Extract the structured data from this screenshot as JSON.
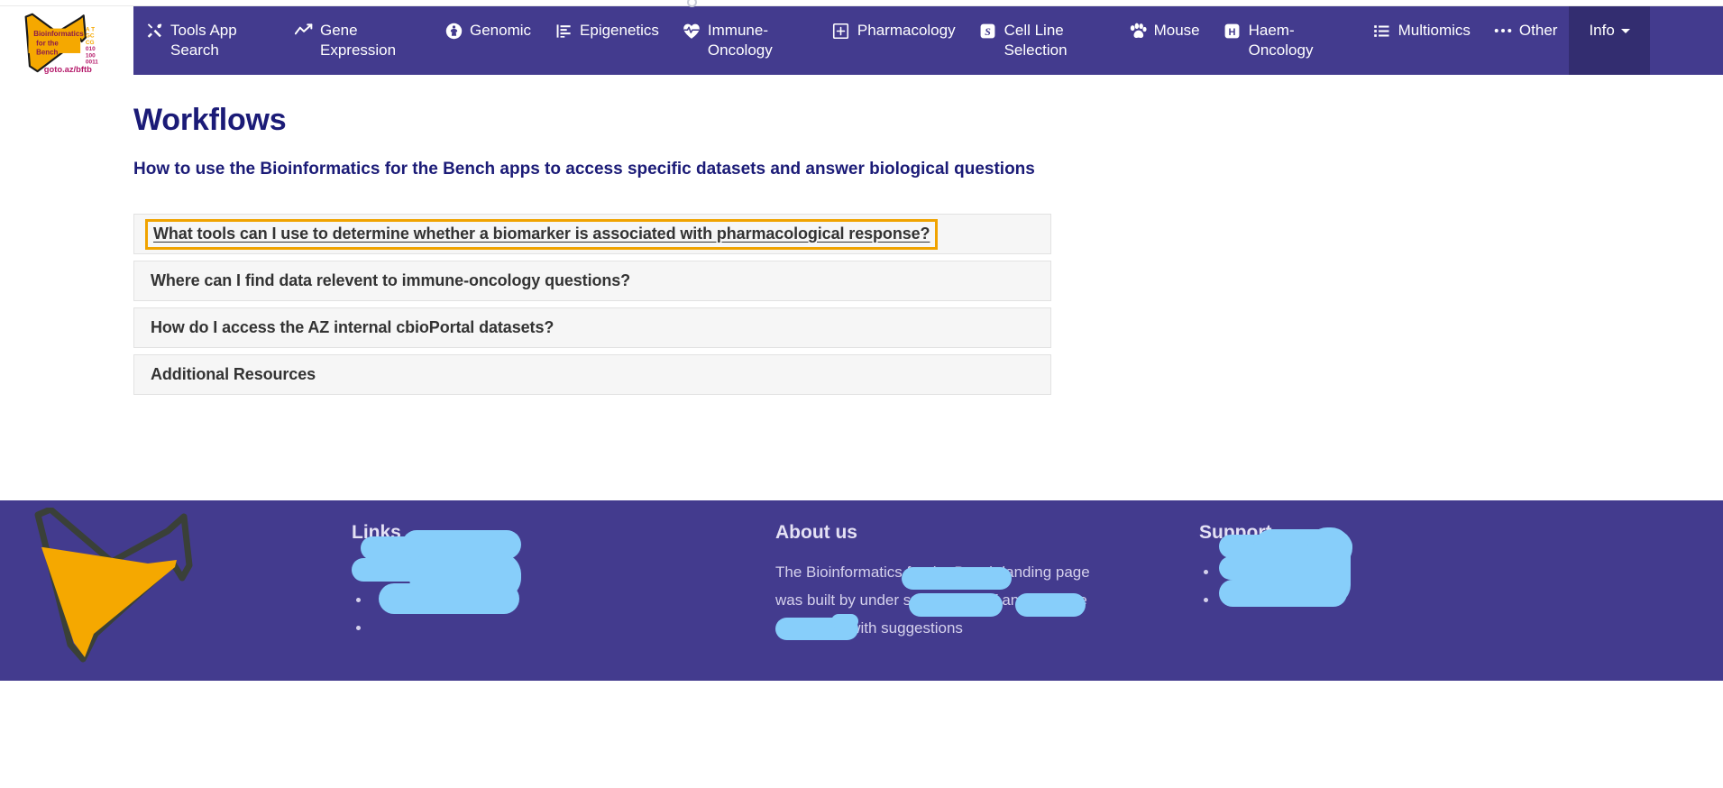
{
  "brand": {
    "logo_alt": "bioinformatics-for-the-bench-logo",
    "logo_line1": "Bioinformatics",
    "logo_line2": "for the",
    "logo_line3": "Bench",
    "logo_url_text": "goto.az/bftb",
    "logo_seq1": "A T",
    "logo_seq2": "GC",
    "logo_seq3": "CG",
    "logo_seq4": "010",
    "logo_seq5": "100",
    "logo_seq6": "0011"
  },
  "colors": {
    "navbar_bg": "#433b8e",
    "navbar_active_bg": "#332d70",
    "heading_blue": "#1b1b77",
    "focus_outline": "#f0a300",
    "logo_amber": "#f5a800",
    "accordion_bg": "#f6f6f6",
    "redaction": "#87cefa"
  },
  "navbar": {
    "items": [
      {
        "label": "Tools App Search",
        "icon": "tools-icon",
        "active": false
      },
      {
        "label": "Gene Expression",
        "icon": "chart-line-icon",
        "active": false
      },
      {
        "label": "Genomic",
        "icon": "dna-person-icon",
        "active": false
      },
      {
        "label": "Epigenetics",
        "icon": "align-left-icon",
        "active": false
      },
      {
        "label": "Immune-Oncology",
        "icon": "heart-pulse-icon",
        "active": false
      },
      {
        "label": "Pharmacology",
        "icon": "plus-square-icon",
        "active": false
      },
      {
        "label": "Cell Line Selection",
        "icon": "s-square-icon",
        "active": false
      },
      {
        "label": "Mouse",
        "icon": "paw-icon",
        "active": false
      },
      {
        "label": "Haem-Oncology",
        "icon": "h-square-icon",
        "active": false
      },
      {
        "label": "Multiomics",
        "icon": "list-ul-icon",
        "active": false
      },
      {
        "label": "Other",
        "icon": "ellipsis-icon",
        "active": false
      },
      {
        "label": "Info",
        "icon": "caret-down-icon",
        "active": true
      }
    ]
  },
  "main": {
    "title": "Workflows",
    "subtitle": "How to use the Bioinformatics for the Bench apps to access specific datasets and answer biological questions",
    "accordion": [
      {
        "label": "What tools can I use to determine whether a biomarker is associated with pharmacological response?",
        "focused": true
      },
      {
        "label": "Where can I find data relevent to immune-oncology questions?",
        "focused": false
      },
      {
        "label": "How do I access the AZ internal cbioPortal datasets?",
        "focused": false
      },
      {
        "label": "Additional Resources",
        "focused": false
      }
    ]
  },
  "footer": {
    "links": {
      "heading": "Links",
      "items": [
        "",
        "",
        ""
      ]
    },
    "about": {
      "heading": "About us",
      "text": "The Bioinformatics for the Bench landing page was built by            under supervision of         and             . Please contact us with suggestions"
    },
    "support": {
      "heading": "Support",
      "items": [
        "",
        ""
      ]
    }
  }
}
